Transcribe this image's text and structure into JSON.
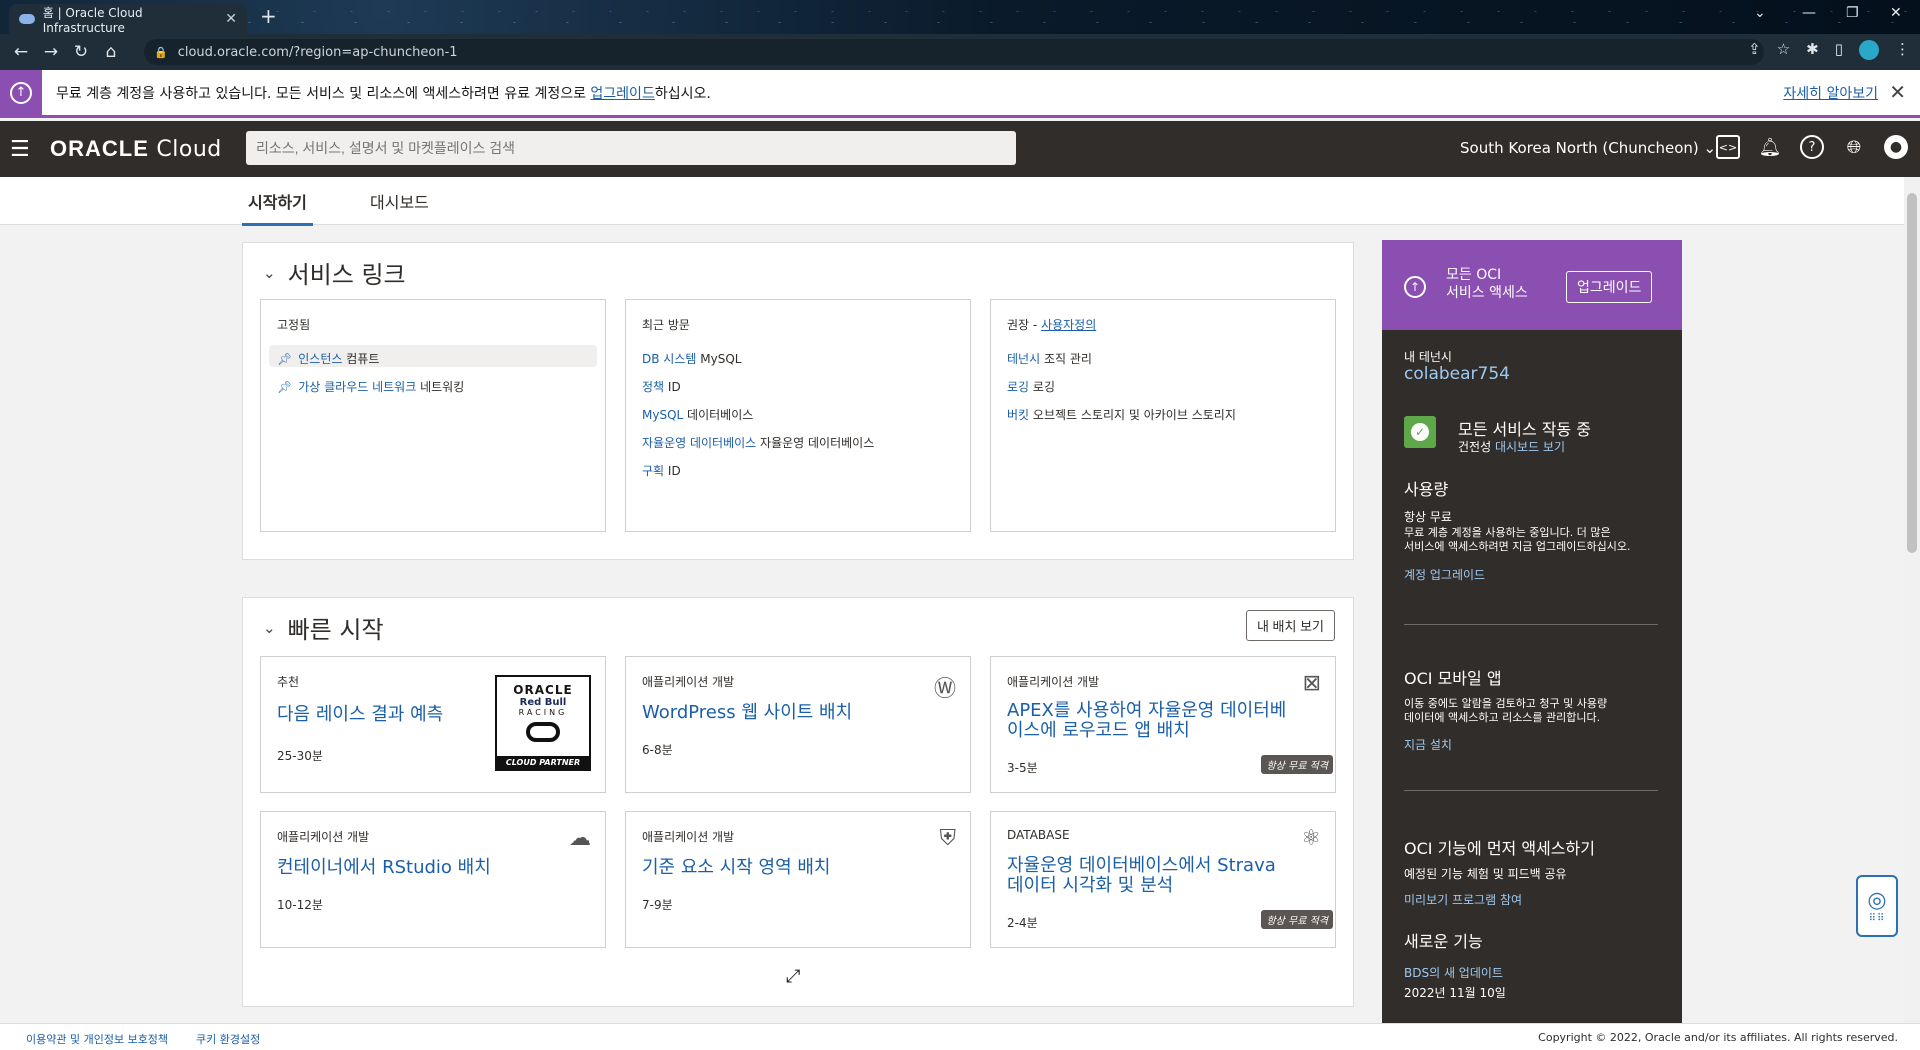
{
  "browser": {
    "tab_title": "홈 | Oracle Cloud Infrastructure",
    "url": "cloud.oracle.com/?region=ap-chuncheon-1"
  },
  "banner": {
    "message": "무료 계층 계정을 사용하고 있습니다. 모든 서비스 및 리소스에 액세스하려면 유료 계정으로",
    "link": "업그레이드",
    "suffix": "하십시오.",
    "learn_more": "자세히 알아보기"
  },
  "header": {
    "logo_oracle": "ORACLE",
    "logo_cloud": "Cloud",
    "search_placeholder": "리소스, 서비스, 설명서 및 마켓플레이스 검색",
    "region": "South Korea North (Chuncheon)"
  },
  "tabs": [
    {
      "label": "시작하기",
      "active": true
    },
    {
      "label": "대시보드",
      "active": false
    }
  ],
  "service_links": {
    "title": "서비스 링크",
    "pinned": {
      "title": "고정됨",
      "items": [
        {
          "link": "인스턴스",
          "rest": "컴퓨트"
        },
        {
          "link": "가상 클라우드 네트워크",
          "rest": "네트워킹"
        }
      ]
    },
    "recent": {
      "title": "최근 방문",
      "items": [
        {
          "link": "DB 시스템",
          "rest": "MySQL"
        },
        {
          "link": "정책",
          "rest": "ID"
        },
        {
          "link": "MySQL",
          "rest": "데이터베이스"
        },
        {
          "link": "자율운영 데이터베이스",
          "rest": "자율운영 데이터베이스"
        },
        {
          "link": "구획",
          "rest": "ID"
        }
      ]
    },
    "recommended": {
      "title": "권장 -",
      "title_link": "사용자정의",
      "items": [
        {
          "link": "테넌시",
          "rest": "조직 관리"
        },
        {
          "link": "로깅",
          "rest": "로깅"
        },
        {
          "link": "버킷",
          "rest": "오브젝트 스토리지 및 아카이브 스토리지"
        }
      ]
    }
  },
  "quick_start": {
    "title": "빠른 시작",
    "deploy_button": "내 배치 보기",
    "cards": [
      {
        "category": "추천",
        "title": "다음 레이스 결과 예측",
        "duration": "25-30분"
      },
      {
        "category": "애플리케이션 개발",
        "title": "WordPress 웹 사이트 배치",
        "duration": "6-8분"
      },
      {
        "category": "애플리케이션 개발",
        "title": "APEX를 사용하여 자율운영 데이터베이스에 로우코드 앱 배치",
        "duration": "3-5분",
        "badge": "항상 무료 적격"
      },
      {
        "category": "애플리케이션 개발",
        "title": "컨테이너에서 RStudio 배치",
        "duration": "10-12분"
      },
      {
        "category": "애플리케이션 개발",
        "title": "기준 요소 시작 영역 배치",
        "duration": "7-9분"
      },
      {
        "category": "DATABASE",
        "title": "자율운영 데이터베이스에서 Strava 데이터 시각화 및 분석",
        "duration": "2-4분",
        "badge": "항상 무료 적격"
      }
    ],
    "logo": {
      "line1": "ORACLE",
      "line2": "Red Bull",
      "line3": "RACING",
      "line4": "CLOUD PARTNER"
    }
  },
  "sidebar": {
    "upgrade_text1": "모든 OCI",
    "upgrade_text2": "서비스 액세스",
    "upgrade_button": "업그레이드",
    "tenancy_label": "내 테넌시",
    "tenancy_name": "colabear754",
    "status_title": "모든 서비스 작동 중",
    "status_sub": "건전성",
    "status_link": "대시보드 보기",
    "usage_title": "사용량",
    "usage_sub": "항상 무료",
    "usage_desc1": "무료 계층 계정을 사용하는 중입니다. 더 많은",
    "usage_desc2": "서비스에 액세스하려면 지금 업그레이드하십시오.",
    "usage_link": "계정 업그레이드",
    "mobile_title": "OCI 모바일 앱",
    "mobile_desc1": "이동 중에도 알람을 검토하고 청구 및 사용량",
    "mobile_desc2": "데이터에 액세스하고 리소스를 관리합니다.",
    "mobile_link": "지금 설치",
    "early_title": "OCI 기능에 먼저 액세스하기",
    "early_desc": "예정된 기능 체험 및 피드백 공유",
    "early_link": "미리보기 프로그램 참여",
    "new_title": "새로운 기능",
    "new_link": "BDS의 새 업데이트",
    "new_date": "2022년 11월 10일"
  },
  "footer": {
    "terms": "이용약관 및 개인정보 보호정책",
    "cookies": "쿠키 환경설정",
    "copyright": "Copyright © 2022, Oracle and/or its affiliates. All rights reserved."
  },
  "colors": {
    "accent": "#8b4fb2",
    "header": "#312d2a",
    "link": "#1b5fa8",
    "status": "#5fa84a"
  }
}
